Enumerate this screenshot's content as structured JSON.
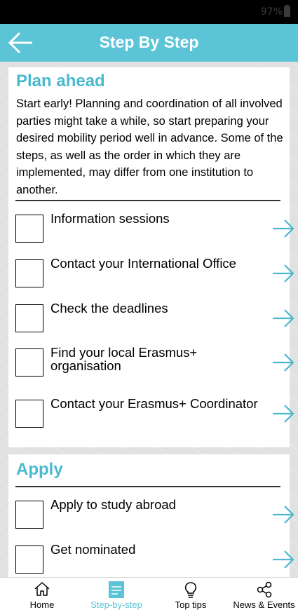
{
  "status_bar": {
    "battery_text": "97%"
  },
  "app_bar": {
    "title": "Step By Step",
    "back_icon": "arrow-left-icon"
  },
  "sections": [
    {
      "heading": "Plan ahead",
      "intro": "Start early! Planning and coordination of all involved parties might take a while, so start preparing your desired mobility period well in advance. Some of the steps, as well as the order in which they are implemented, may differ from one institution to another.",
      "steps": [
        {
          "label": "Information sessions"
        },
        {
          "label": "Contact your International Office"
        },
        {
          "label": "Check the deadlines"
        },
        {
          "label": "Find your local Erasmus+ organisation"
        },
        {
          "label": "Contact your Erasmus+ Coordinator"
        }
      ]
    },
    {
      "heading": "Apply",
      "steps": [
        {
          "label": "Apply to study abroad"
        },
        {
          "label": "Get nominated"
        }
      ]
    }
  ],
  "bottom_nav": {
    "items": [
      {
        "label": "Home",
        "icon": "home-icon"
      },
      {
        "label": "Step-by-step",
        "icon": "list-icon",
        "active": true
      },
      {
        "label": "Top tips",
        "icon": "lightbulb-icon"
      },
      {
        "label": "News & Events",
        "icon": "share-icon"
      }
    ]
  },
  "colors": {
    "accent": "#5bc4d6",
    "heading": "#4ab9cf",
    "status_bar": "#000000"
  }
}
